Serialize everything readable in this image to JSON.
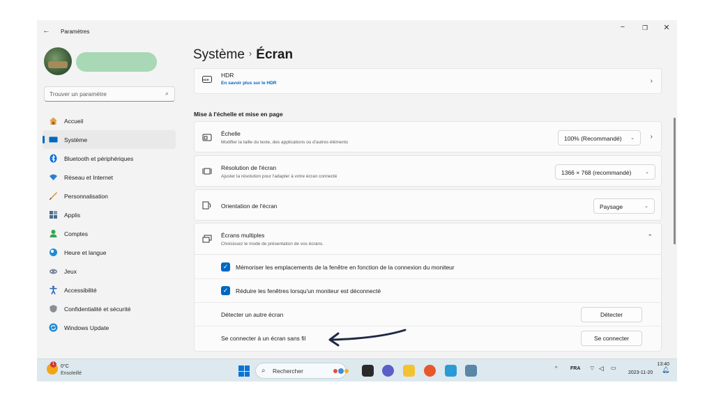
{
  "window": {
    "back_glyph": "←",
    "title": "Paramètres",
    "minimize_glyph": "−",
    "restore_glyph": "❐",
    "close_glyph": "✕"
  },
  "sidebar": {
    "search_placeholder": "Trouver un paramètre",
    "items": [
      {
        "label": "Accueil",
        "icon": "home-icon",
        "color": "#e3a14b"
      },
      {
        "label": "Système",
        "icon": "system-icon",
        "color": "#0067c0"
      },
      {
        "label": "Bluetooth et périphériques",
        "icon": "bluetooth-icon",
        "color": "#0a6fd6"
      },
      {
        "label": "Réseau et Internet",
        "icon": "network-icon",
        "color": "#2a7ed2"
      },
      {
        "label": "Personnalisation",
        "icon": "brush-icon",
        "color": "#d98a2b"
      },
      {
        "label": "Applis",
        "icon": "apps-icon",
        "color": "#4a6c8c"
      },
      {
        "label": "Comptes",
        "icon": "accounts-icon",
        "color": "#2fa84f"
      },
      {
        "label": "Heure et langue",
        "icon": "clock-globe-icon",
        "color": "#1f8ad6"
      },
      {
        "label": "Jeux",
        "icon": "gamepad-icon",
        "color": "#7a8a9a"
      },
      {
        "label": "Accessibilité",
        "icon": "accessibility-icon",
        "color": "#1a5fb4"
      },
      {
        "label": "Confidentialité et sécurité",
        "icon": "shield-icon",
        "color": "#7a7f86"
      },
      {
        "label": "Windows Update",
        "icon": "update-icon",
        "color": "#1f8ad6"
      }
    ]
  },
  "main": {
    "breadcrumb_parent": "Système",
    "breadcrumb_sep": "›",
    "breadcrumb_current": "Écran",
    "hdr": {
      "icon_text": "HDR",
      "title": "HDR",
      "link": "En savoir plus sur le HDR"
    },
    "section_title": "Mise à l'échelle et mise en page",
    "scale": {
      "title": "Échelle",
      "subtitle": "Modifier la taille du texte, des applications ou d'autres éléments",
      "value": "100% (Recommandé)"
    },
    "resolution": {
      "title": "Résolution de l'écran",
      "subtitle": "Ajuster la résolution pour l'adapter à  votre  écran connecté",
      "value": "1366 × 768 (recommandé)"
    },
    "orientation": {
      "title": "Orientation de l'écran",
      "value": "Paysage"
    },
    "multi": {
      "title": "Écrans multiples",
      "subtitle": "Choisissez le mode de présentation de vos écrans."
    },
    "remember_windows": {
      "label": "Mémoriser les emplacements de la fenêtre en fonction de la connexion du moniteur",
      "checked": true
    },
    "minimize_windows": {
      "label": "Réduire les fenêtres lorsqu'un moniteur est déconnecté",
      "checked": true
    },
    "detect": {
      "label": "Détecter un autre écran",
      "button": "Détecter"
    },
    "wireless": {
      "label": "Se connecter à un écran sans fil",
      "button": "Se connecter"
    }
  },
  "taskbar": {
    "weather_temp": "0°C",
    "weather_desc": "Ensoleillé",
    "weather_badge": "1",
    "search_label": "Rechercher",
    "tray_language": "FRA",
    "tray_chevron": "^",
    "time": "13:40",
    "date": "2023-11-20",
    "accent": "#0a74d6"
  }
}
